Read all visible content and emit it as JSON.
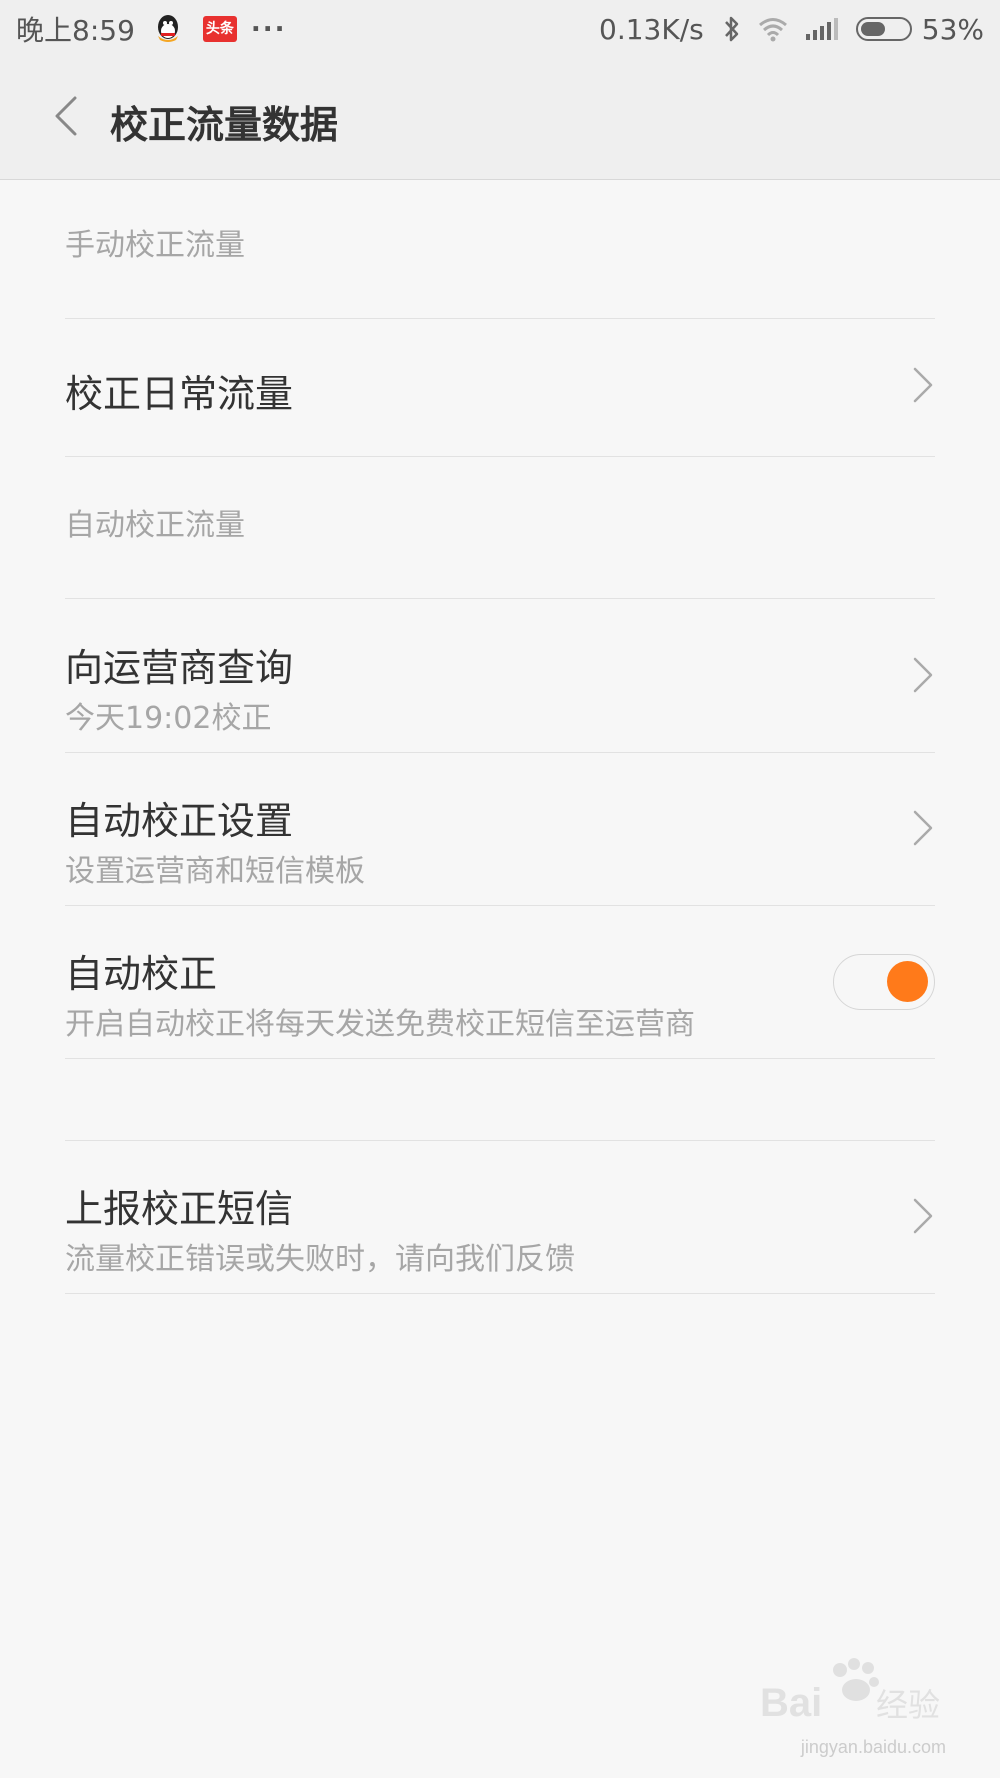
{
  "status_bar": {
    "time": "晚上8:59",
    "toutiao_icon_text": "头条",
    "more": "...",
    "net_speed": "0.13K/s",
    "battery_percent": "53%",
    "battery_level": 0.53,
    "icons": [
      "qq-icon",
      "toutiao-icon",
      "bluetooth-icon",
      "wifi-icon",
      "signal-icon",
      "battery-icon"
    ]
  },
  "header": {
    "title": "校正流量数据"
  },
  "sections": {
    "manual": {
      "header": "手动校正流量",
      "items": [
        {
          "title": "校正日常流量"
        }
      ]
    },
    "auto": {
      "header": "自动校正流量",
      "items": [
        {
          "title": "向运营商查询",
          "subtitle": "今天19:02校正"
        },
        {
          "title": "自动校正设置",
          "subtitle": "设置运营商和短信模板"
        },
        {
          "title": "自动校正",
          "subtitle": "开启自动校正将每天发送免费校正短信至运营商",
          "toggle_on": true
        }
      ]
    },
    "report": {
      "items": [
        {
          "title": "上报校正短信",
          "subtitle": "流量校正错误或失败时，请向我们反馈"
        }
      ]
    }
  },
  "colors": {
    "accent": "#ff7a1a",
    "background": "#f7f7f7",
    "header_bg": "#efefef"
  },
  "watermark": {
    "brand": "Baidu经验",
    "url": "jingyan.baidu.com"
  }
}
